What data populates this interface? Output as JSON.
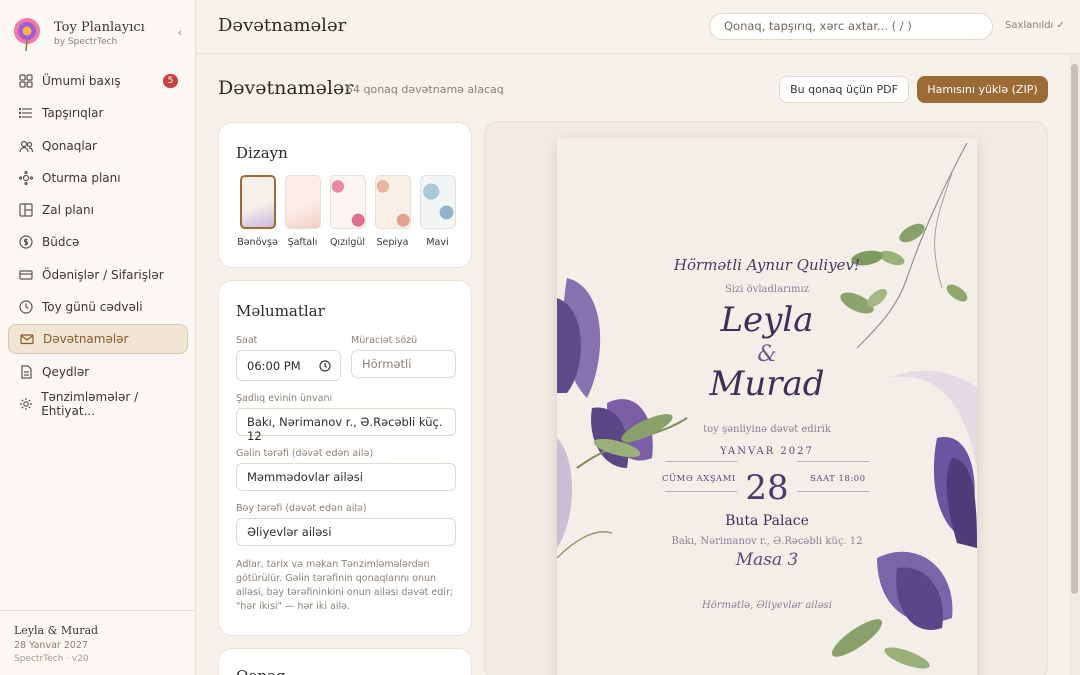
{
  "brand": {
    "title": "Toy Planlayıcı",
    "subtitle": "by SpectrTech",
    "collapse_glyph": "‹"
  },
  "nav": [
    {
      "label": "Ümumi baxış",
      "icon": "grid-icon",
      "badge": "5"
    },
    {
      "label": "Tapşırıqlar",
      "icon": "list-icon"
    },
    {
      "label": "Qonaqlar",
      "icon": "users-icon"
    },
    {
      "label": "Oturma planı",
      "icon": "seating-icon"
    },
    {
      "label": "Zal planı",
      "icon": "layout-icon"
    },
    {
      "label": "Büdcə",
      "icon": "coin-icon"
    },
    {
      "label": "Ödənişlər / Sifarişlər",
      "icon": "card-icon"
    },
    {
      "label": "Toy günü cədvəli",
      "icon": "clock-icon"
    },
    {
      "label": "Dəvətnamələr",
      "icon": "envelope-icon",
      "active": true
    },
    {
      "label": "Qeydlər",
      "icon": "note-icon"
    },
    {
      "label": "Tənzimləmələr / Ehtiyat...",
      "icon": "gear-icon"
    }
  ],
  "footer": {
    "couple": "Leyla & Murad",
    "date": "28 Yanvar 2027",
    "version": "SpectrTech · v20"
  },
  "topbar": {
    "title": "Dəvətnamələr",
    "search_placeholder": "Qonaq, tapşırıq, xərc axtar...  ( / )",
    "saved": "Saxlanıldı ✓"
  },
  "page": {
    "title": "Dəvətnamələr",
    "subtitle": "54 qonaq dəvətnamə alacaq",
    "pdf_button": "Bu qonaq üçün PDF",
    "zip_button": "Hamısını yüklə (ZIP)"
  },
  "design": {
    "title": "Dizayn",
    "themes": [
      {
        "label": "Bənövşə",
        "selected": true,
        "color": "#ece4ef"
      },
      {
        "label": "Şaftalı",
        "color": "#f7e6e1"
      },
      {
        "label": "Qızılgül",
        "color": "#faf0f0"
      },
      {
        "label": "Sepiya",
        "color": "#f3e8dc"
      },
      {
        "label": "Mavi",
        "color": "#e8f0f3"
      }
    ]
  },
  "info": {
    "title": "Məlumatlar",
    "time_label": "Saat",
    "time_value": "06:00 PM",
    "address_label": "Müraciət sözü",
    "address_placeholder": "Hörmətli",
    "venue_label": "Şadlıq evinin ünvanı",
    "venue_value": "Bakı, Nərimanov r., Ə.Rəcəbli küç. 12",
    "bride_label": "Gəlin tərəfi (dəvət edən ailə)",
    "bride_value": "Məmmədovlar ailəsi",
    "groom_label": "Bəy tərəfi (dəvət edən ailə)",
    "groom_value": "Əliyevlər ailəsi",
    "note": "Adlar, tarix və məkan Tənzimləmələrdən götürülür. Gəlin tərəfinin qonaqlarını onun ailəsi, bəy tərəfininkini onun ailəsi dəvət edir; \"hər ikisi\" — hər iki ailə."
  },
  "card3_title": "Qonaq",
  "invitation": {
    "salutation": "Hörmətli Aynur Quliyev!",
    "intro": "Sizi övladlarımız",
    "bride": "Leyla",
    "amp": "&",
    "groom": "Murad",
    "invite_line": "toy şənliyinə dəvət edirik",
    "month_year": "YANVAR 2027",
    "day": "28",
    "weekday": "CÜMƏ AXŞAMI",
    "time": "SAAT 18:00",
    "venue_name": "Buta Palace",
    "venue_address": "Bakı, Nərimanov r., Ə.Rəcəbli küç. 12",
    "table": "Masa 3",
    "signature": "Hörmətlə, Əliyevlər ailəsi"
  },
  "colors": {
    "accent": "#9b6a35",
    "badge": "#c7423b",
    "flower": "#6e5699",
    "leaf": "#8a9a5b"
  }
}
